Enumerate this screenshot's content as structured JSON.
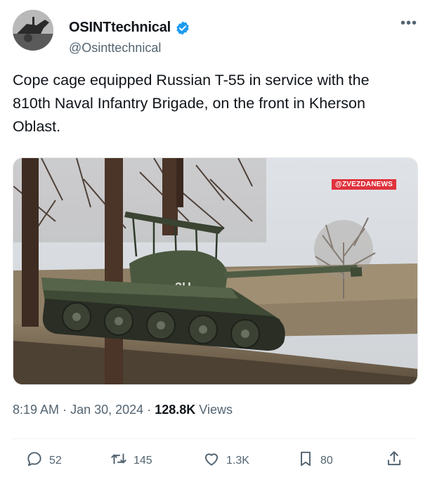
{
  "author": {
    "display_name": "OSINTtechnical",
    "handle": "@Osinttechnical",
    "verified_color": "#1d9bf0"
  },
  "more_icon": "more-horizontal-icon",
  "tweet": {
    "text": "Cope cage equipped Russian T-55 in service with the 810th Naval Infantry Brigade, on the front in Kherson Oblast.",
    "media_watermark": "@ZVEZDANEWS",
    "media_turret_marking": "3Н"
  },
  "meta": {
    "time": "8:19 AM",
    "separator": "·",
    "date": "Jan 30, 2024",
    "views_count": "128.8K",
    "views_label": "Views"
  },
  "actions": {
    "reply": {
      "icon": "reply-icon",
      "count": "52"
    },
    "retweet": {
      "icon": "retweet-icon",
      "count": "145"
    },
    "like": {
      "icon": "heart-icon",
      "count": "1.3K"
    },
    "bookmark": {
      "icon": "bookmark-icon",
      "count": "80"
    },
    "share": {
      "icon": "share-icon"
    }
  },
  "colors": {
    "text": "#0f1419",
    "secondary": "#536471",
    "watermark_bg": "#e0323c"
  }
}
